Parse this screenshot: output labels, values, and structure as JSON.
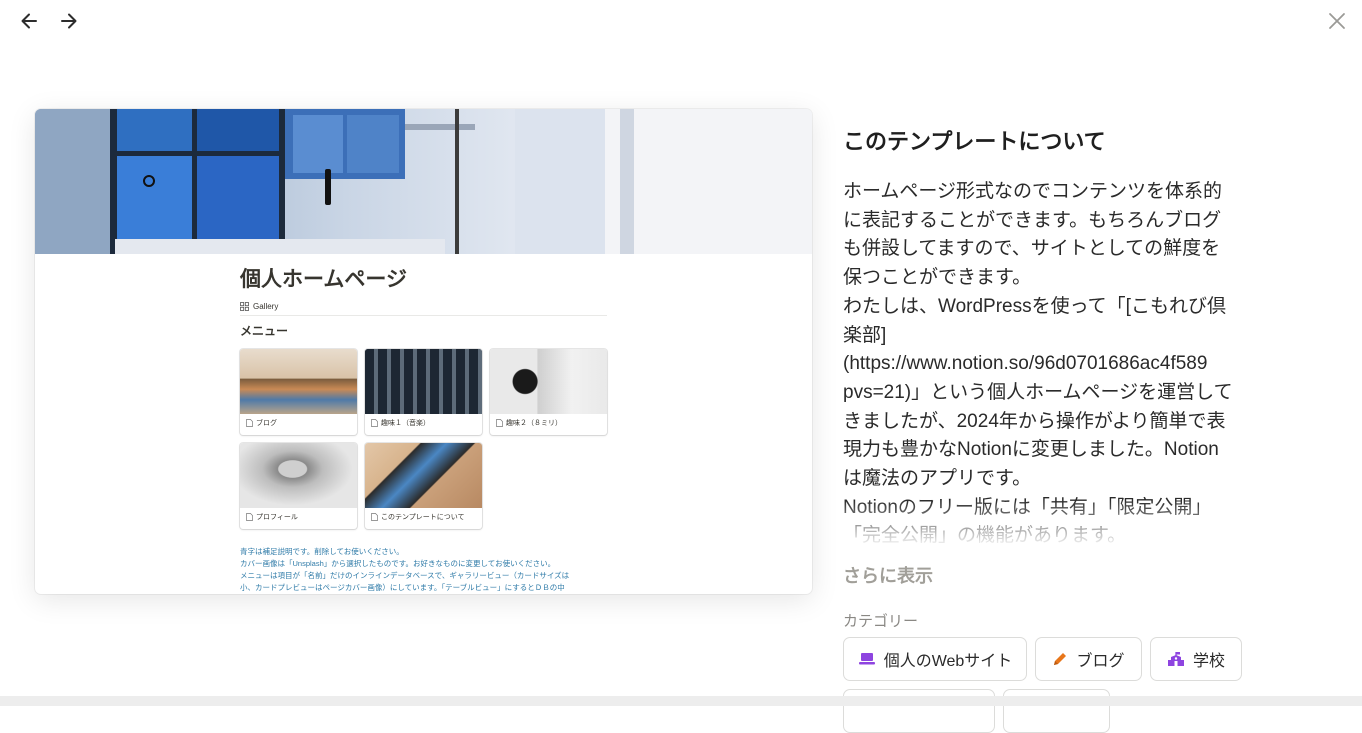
{
  "nav": {
    "back_icon": "arrow-left-icon",
    "forward_icon": "arrow-right-icon",
    "close_icon": "close-icon"
  },
  "preview": {
    "page_title": "個人ホームページ",
    "view_tab": "Gallery",
    "section_title": "メニュー",
    "cards": [
      {
        "label": "ブログ"
      },
      {
        "label": "趣味１（音楽）"
      },
      {
        "label": "趣味２（８ミリ）"
      },
      {
        "label": "プロフィール"
      },
      {
        "label": "このテンプレートについて"
      }
    ],
    "notes": [
      "青字は補足説明です。削除してお使いください。",
      "カバー画像は「Unsplash」から選択したものです。お好きなものに変更してお使いください。",
      "メニューは項目が「名前」だけのインラインデータベースで、ギャラリービュー（カードサイズは",
      "小、カードプレビューはページカバー画像）にしています。「テーブルビュー」にするとＤＢの中"
    ]
  },
  "about": {
    "title": "このテンプレートについて",
    "body": "ホームページ形式なのでコンテンツを体系的\nに表記することができます。もちろんブログ\nも併設してますので、サイトとしての鮮度を\n保つことができます。\nわたしは、WordPressを使って「[こもれび倶\n楽部]\n(https://www.notion.so/96d0701686ac4f589\npvs=21)」という個人ホームページを運営して\nきましたが、2024年から操作がより簡単で表\n現力も豊かなNotionに変更しました。Notion\nは魔法のアプリです。\nNotionのフリー版には「共有」「限定公開」\n「完全公開」の機能があります。",
    "show_more": "さらに表示",
    "category_label": "カテゴリー",
    "categories": [
      {
        "label": "個人のWebサイト",
        "icon": "laptop-icon",
        "color": "#8e44e0"
      },
      {
        "label": "ブログ",
        "icon": "pencil-icon",
        "color": "#e8761a"
      },
      {
        "label": "学校",
        "icon": "school-icon",
        "color": "#8e44e0"
      }
    ]
  }
}
